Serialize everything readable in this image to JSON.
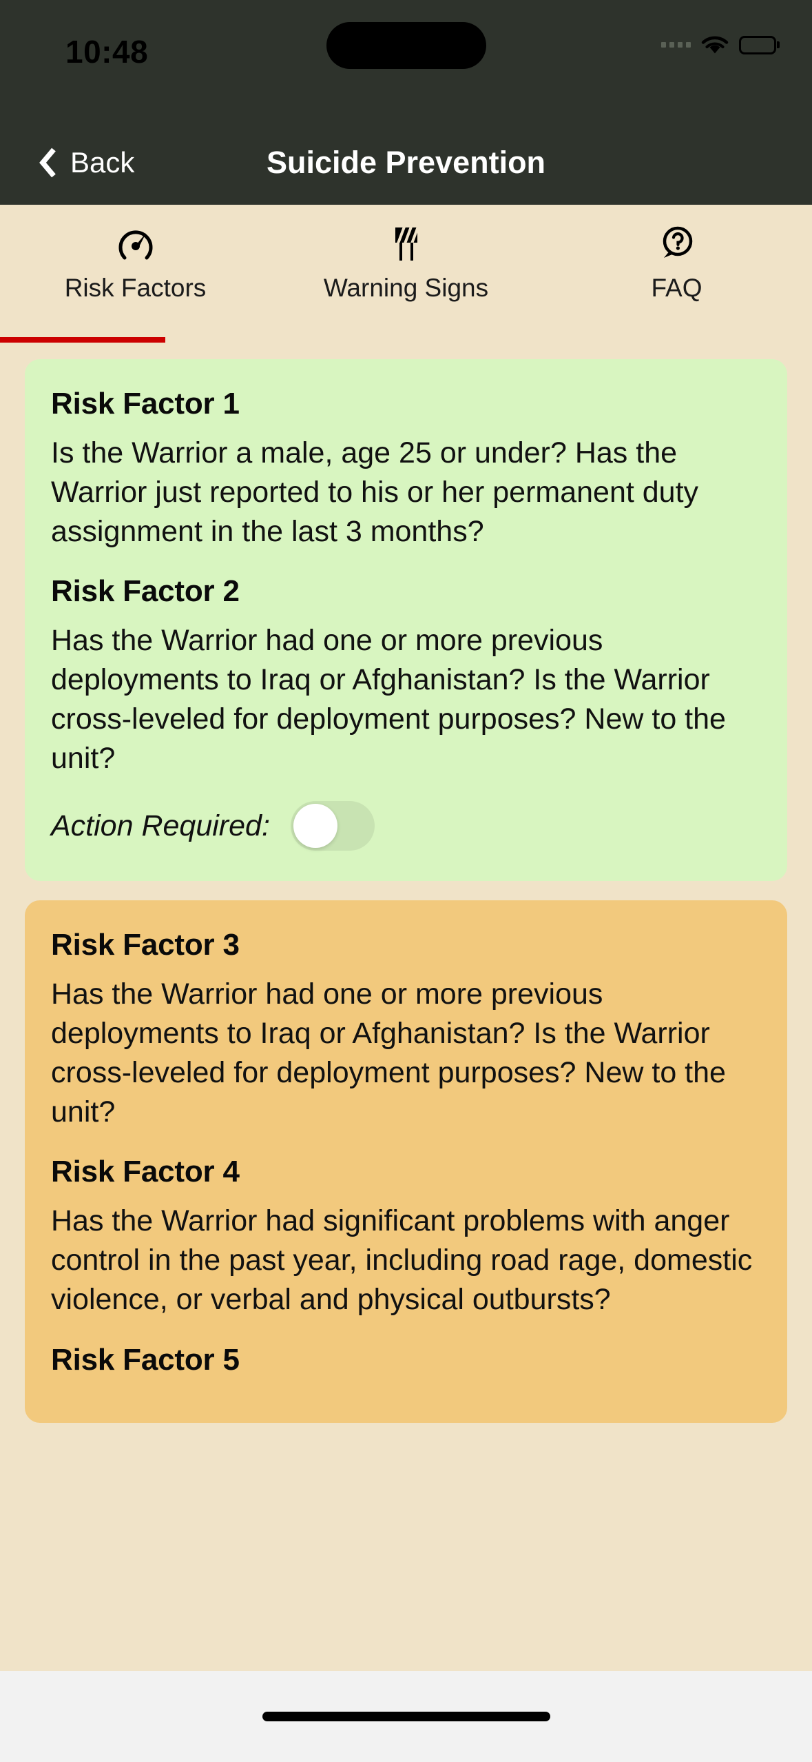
{
  "status_bar": {
    "time": "10:48",
    "cellular_icon": "signal-dots-icon",
    "wifi_icon": "wifi-icon",
    "battery_icon": "battery-icon"
  },
  "nav": {
    "back_label": "Back",
    "back_icon": "chevron-left-icon",
    "title": "Suicide Prevention"
  },
  "tabs": [
    {
      "label": "Risk Factors",
      "icon": "gauge-icon",
      "active": true
    },
    {
      "label": "Warning Signs",
      "icon": "road-barrier-icon",
      "active": false
    },
    {
      "label": "FAQ",
      "icon": "question-bubble-icon",
      "active": false
    }
  ],
  "cards": [
    {
      "color": "green",
      "items": [
        {
          "title": "Risk Factor 1",
          "body": "Is the Warrior a male, age 25 or under? Has the Warrior just reported to his or her permanent duty assignment in the last 3 months?"
        },
        {
          "title": "Risk Factor 2",
          "body": "Has the Warrior had one or more previous deployments to Iraq or Afghanistan? Is the Warrior cross-leveled for deployment purposes? New to the unit?"
        }
      ],
      "action": {
        "label": "Action Required:",
        "toggle_on": false
      }
    },
    {
      "color": "orange",
      "items": [
        {
          "title": "Risk Factor 3",
          "body": "Has the Warrior had one or more previous deployments to Iraq or Afghanistan? Is the Warrior cross-leveled for deployment purposes? New to the unit?"
        },
        {
          "title": "Risk Factor 4",
          "body": "Has the Warrior had significant problems with anger control in the past year, including road rage, domestic violence, or verbal and physical outbursts?"
        },
        {
          "title": "Risk Factor 5",
          "body": ""
        }
      ]
    }
  ],
  "colors": {
    "header_bg": "#2e332c",
    "page_bg": "#f0e3c8",
    "accent_underline": "#cc0000",
    "card_green": "#d8f5c0",
    "card_orange": "#f2c97d",
    "home_bar_bg": "#f2f2f2"
  },
  "home_indicator": "home-indicator"
}
